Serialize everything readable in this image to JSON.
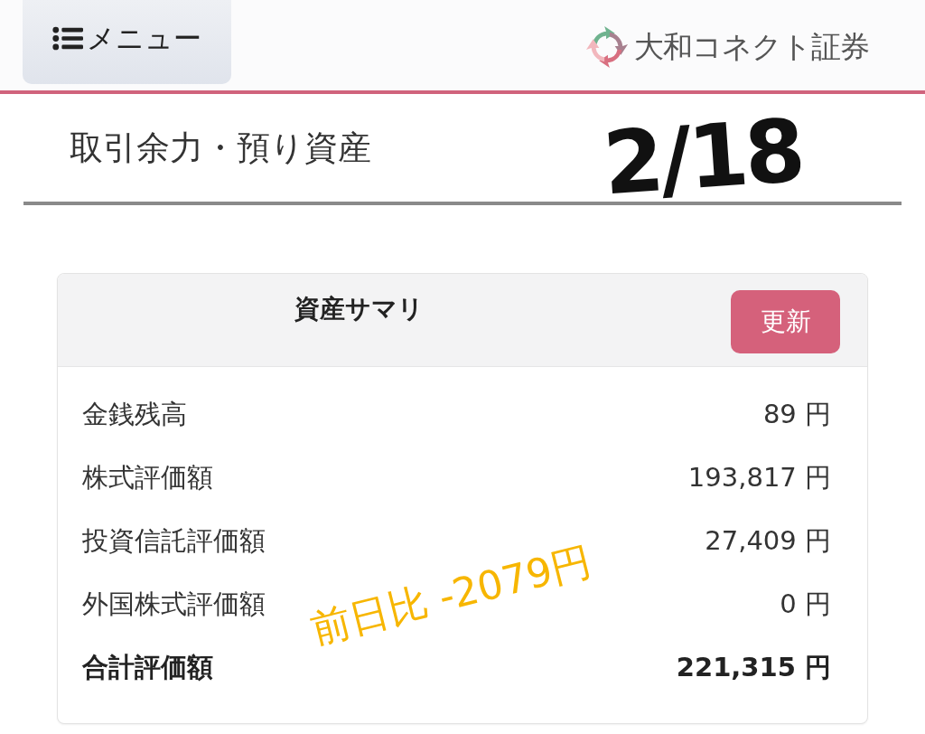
{
  "header": {
    "menu_button": {
      "label": "メニュー"
    },
    "logo": {
      "text": "大和コネクト証券"
    }
  },
  "page_title": "取引余力・預り資産",
  "summary": {
    "title": "資産サマリ",
    "refresh_button": "更新",
    "rows": [
      {
        "kind": "item",
        "label": "金銭残高",
        "value": "89 円"
      },
      {
        "kind": "item",
        "label": "株式評価額",
        "value": "193,817 円"
      },
      {
        "kind": "item",
        "label": "投資信託評価額",
        "value": "27,409 円"
      },
      {
        "kind": "item",
        "label": "外国株式評価額",
        "value": "0 円"
      },
      {
        "kind": "total",
        "label": "合計評価額",
        "value": "221,315 円"
      }
    ]
  },
  "annotations": [
    {
      "kind": "date",
      "text": "2/18",
      "color": "#111111"
    },
    {
      "kind": "note",
      "text": "前日比 -2079円",
      "color": "#f7b600"
    }
  ]
}
